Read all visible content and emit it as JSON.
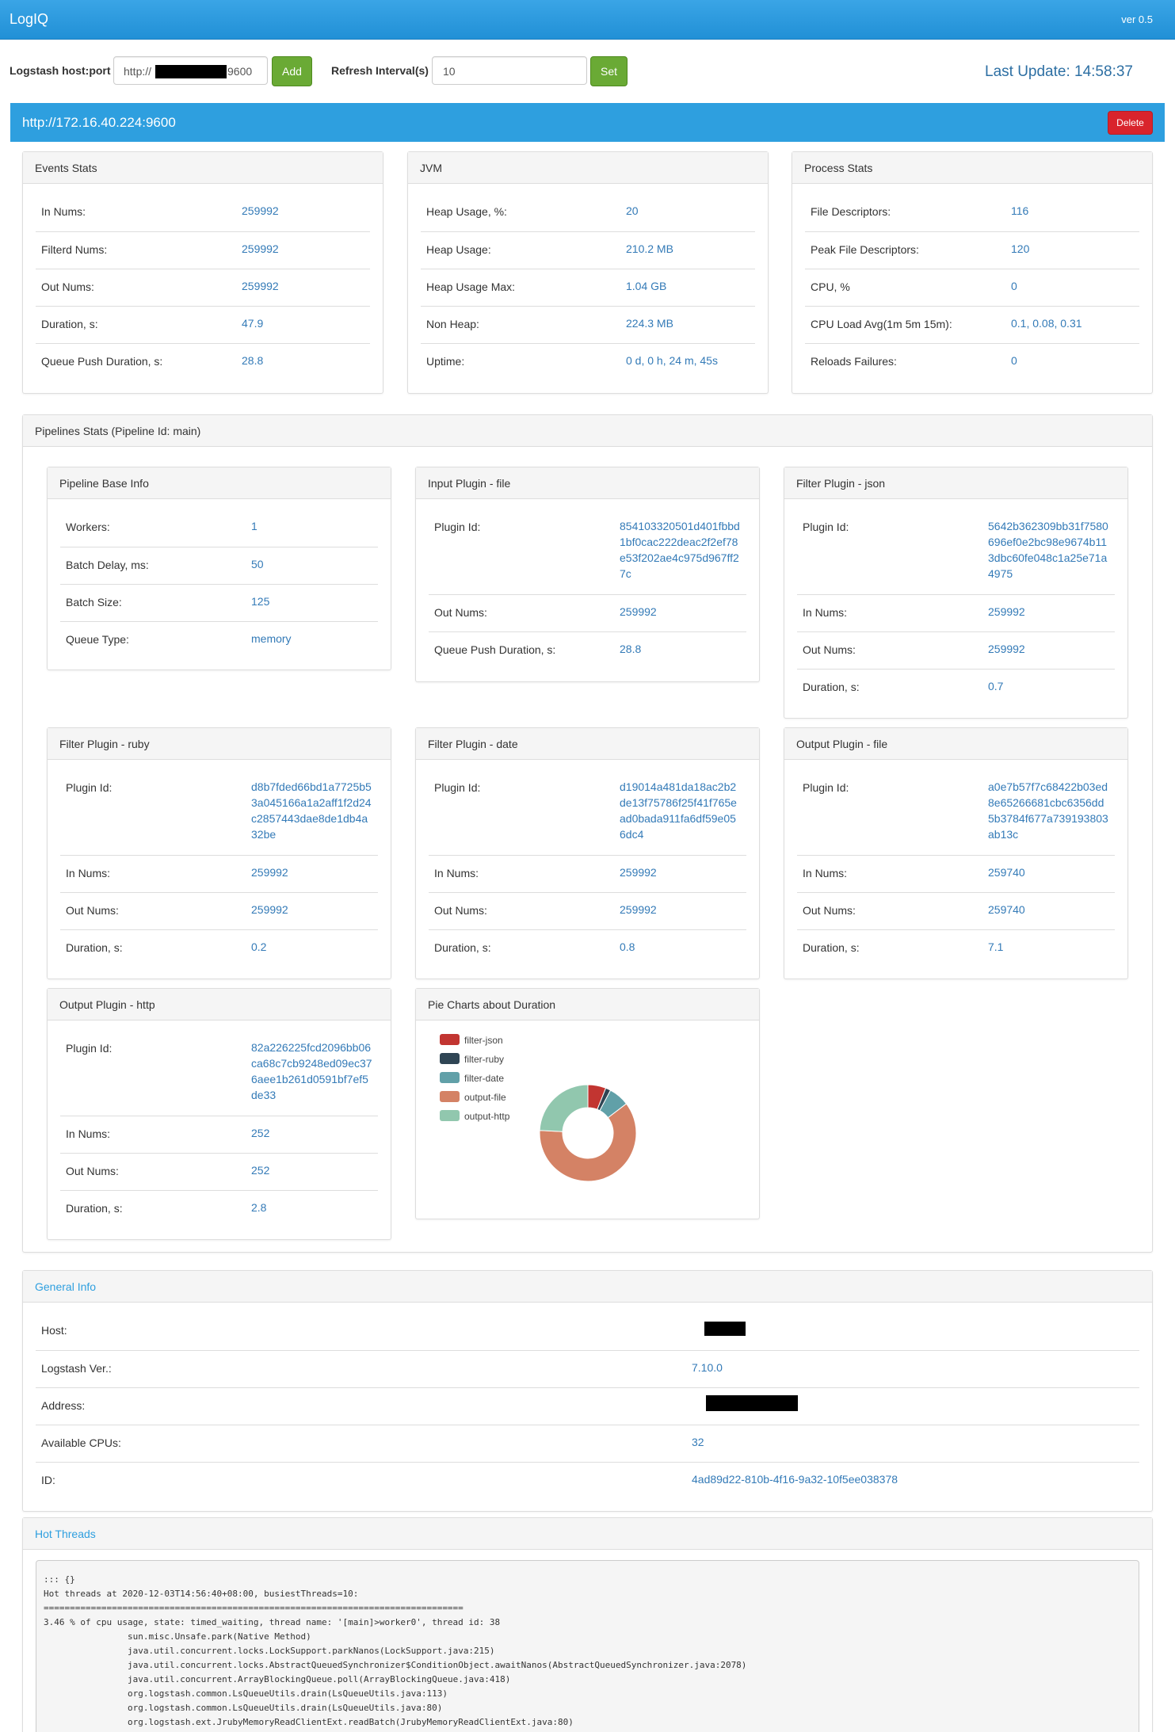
{
  "app": {
    "title": "LogIQ",
    "version": "ver 0.5"
  },
  "controls": {
    "host_label": "Logstash host:port",
    "host_prefix": "http://",
    "host_suffix": "9600",
    "add_label": "Add",
    "refresh_label": "Refresh Interval(s)",
    "refresh_value": "10",
    "set_label": "Set",
    "last_update": "Last Update: 14:58:37"
  },
  "host": {
    "url": "http://172.16.40.224:9600",
    "delete_label": "Delete"
  },
  "events": {
    "title": "Events Stats",
    "rows": [
      {
        "label": "In Nums:",
        "value": "259992"
      },
      {
        "label": "Filterd Nums:",
        "value": "259992"
      },
      {
        "label": "Out Nums:",
        "value": "259992"
      },
      {
        "label": "Duration, s:",
        "value": "47.9"
      },
      {
        "label": "Queue Push Duration, s:",
        "value": "28.8"
      }
    ]
  },
  "jvm": {
    "title": "JVM",
    "rows": [
      {
        "label": "Heap Usage, %:",
        "value": "20"
      },
      {
        "label": "Heap Usage:",
        "value": "210.2 MB"
      },
      {
        "label": "Heap Usage Max:",
        "value": "1.04 GB"
      },
      {
        "label": "Non Heap:",
        "value": "224.3 MB"
      },
      {
        "label": "Uptime:",
        "value": "0 d, 0 h, 24 m, 45s"
      }
    ]
  },
  "process": {
    "title": "Process Stats",
    "rows": [
      {
        "label": "File Descriptors:",
        "value": "116"
      },
      {
        "label": "Peak File Descriptors:",
        "value": "120"
      },
      {
        "label": "CPU, %",
        "value": "0"
      },
      {
        "label": "CPU Load Avg(1m 5m 15m):",
        "value": "0.1, 0.08, 0.31"
      },
      {
        "label": "Reloads Failures:",
        "value": "0"
      }
    ]
  },
  "pipelines": {
    "title": "Pipelines Stats (Pipeline Id: main)",
    "base": {
      "title": "Pipeline Base Info",
      "rows": [
        {
          "label": "Workers:",
          "value": "1"
        },
        {
          "label": "Batch Delay, ms:",
          "value": "50"
        },
        {
          "label": "Batch Size:",
          "value": "125"
        },
        {
          "label": "Queue Type:",
          "value": "memory"
        }
      ]
    },
    "input_file": {
      "title": "Input Plugin - file",
      "rows": [
        {
          "label": "Plugin Id:",
          "value": "854103320501d401fbbd1bf0cac222deac2f2ef78e53f202ae4c975d967ff27c"
        },
        {
          "label": "Out Nums:",
          "value": "259992"
        },
        {
          "label": "Queue Push Duration, s:",
          "value": "28.8"
        }
      ]
    },
    "filter_json": {
      "title": "Filter Plugin - json",
      "rows": [
        {
          "label": "Plugin Id:",
          "value": "5642b362309bb31f7580696ef0e2bc98e9674b113dbc60fe048c1a25e71a4975"
        },
        {
          "label": "In Nums:",
          "value": "259992"
        },
        {
          "label": "Out Nums:",
          "value": "259992"
        },
        {
          "label": "Duration, s:",
          "value": "0.7"
        }
      ]
    },
    "filter_ruby": {
      "title": "Filter Plugin - ruby",
      "rows": [
        {
          "label": "Plugin Id:",
          "value": "d8b7fded66bd1a7725b53a045166a1a2aff1f2d24c2857443dae8de1db4a32be"
        },
        {
          "label": "In Nums:",
          "value": "259992"
        },
        {
          "label": "Out Nums:",
          "value": "259992"
        },
        {
          "label": "Duration, s:",
          "value": "0.2"
        }
      ]
    },
    "filter_date": {
      "title": "Filter Plugin - date",
      "rows": [
        {
          "label": "Plugin Id:",
          "value": "d19014a481da18ac2b2de13f75786f25f41f765ead0bada911fa6df59e056dc4"
        },
        {
          "label": "In Nums:",
          "value": "259992"
        },
        {
          "label": "Out Nums:",
          "value": "259992"
        },
        {
          "label": "Duration, s:",
          "value": "0.8"
        }
      ]
    },
    "output_file": {
      "title": "Output Plugin - file",
      "rows": [
        {
          "label": "Plugin Id:",
          "value": "a0e7b57f7c68422b03ed8e65266681cbc6356dd5b3784f677a739193803ab13c"
        },
        {
          "label": "In Nums:",
          "value": "259740"
        },
        {
          "label": "Out Nums:",
          "value": "259740"
        },
        {
          "label": "Duration, s:",
          "value": "7.1"
        }
      ]
    },
    "output_http": {
      "title": "Output Plugin - http",
      "rows": [
        {
          "label": "Plugin Id:",
          "value": "82a226225fcd2096bb06ca68c7cb9248ed09ec376aee1b261d0591bf7ef5de33"
        },
        {
          "label": "In Nums:",
          "value": "252"
        },
        {
          "label": "Out Nums:",
          "value": "252"
        },
        {
          "label": "Duration, s:",
          "value": "2.8"
        }
      ]
    },
    "pie_title": "Pie Charts about Duration"
  },
  "chart_data": {
    "type": "pie",
    "categories": [
      "filter-json",
      "filter-ruby",
      "filter-date",
      "output-file",
      "output-http"
    ],
    "values": [
      0.7,
      0.2,
      0.8,
      7.1,
      2.8
    ],
    "colors": [
      "#c23531",
      "#2f4554",
      "#61a0a8",
      "#d48265",
      "#91c7ae"
    ],
    "legend": "left"
  },
  "general": {
    "title": "General Info",
    "rows": [
      {
        "label": "Host:",
        "value": ""
      },
      {
        "label": "Logstash Ver.:",
        "value": "7.10.0"
      },
      {
        "label": "Address:",
        "value": ""
      },
      {
        "label": "Available CPUs:",
        "value": "32"
      },
      {
        "label": "ID:",
        "value": "4ad89d22-810b-4f16-9a32-10f5ee038378"
      }
    ]
  },
  "threads": {
    "title": "Hot Threads",
    "text": "::: {}\nHot threads at 2020-12-03T14:56:40+08:00, busiestThreads=10:\n================================================================================\n3.46 % of cpu usage, state: timed_waiting, thread name: '[main]>worker0', thread id: 38\n\t\tsun.misc.Unsafe.park(Native Method)\n\t\tjava.util.concurrent.locks.LockSupport.parkNanos(LockSupport.java:215)\n\t\tjava.util.concurrent.locks.AbstractQueuedSynchronizer$ConditionObject.awaitNanos(AbstractQueuedSynchronizer.java:2078)\n\t\tjava.util.concurrent.ArrayBlockingQueue.poll(ArrayBlockingQueue.java:418)\n\t\torg.logstash.common.LsQueueUtils.drain(LsQueueUtils.java:113)\n\t\torg.logstash.common.LsQueueUtils.drain(LsQueueUtils.java:80)\n\t\torg.logstash.ext.JrubyMemoryReadClientExt.readBatch(JrubyMemoryReadClientExt.java:80)"
  }
}
